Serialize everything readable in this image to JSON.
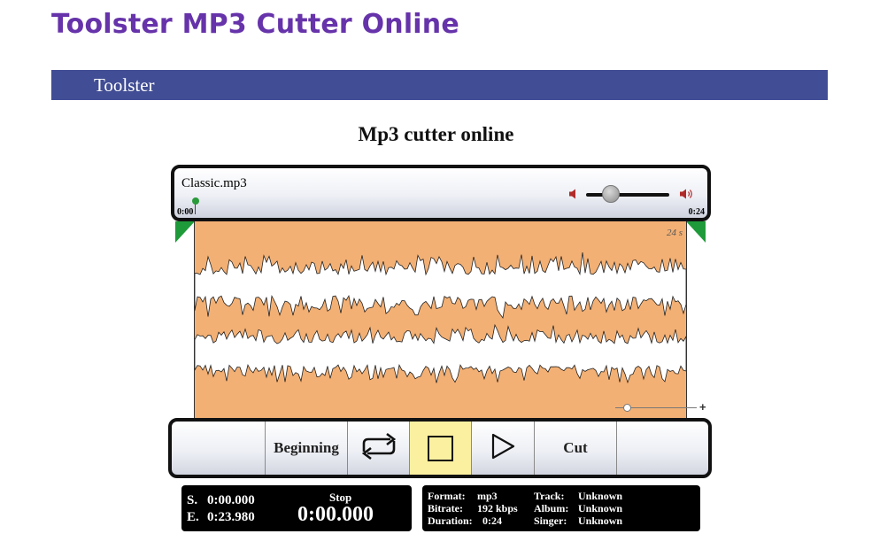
{
  "page": {
    "title": "Toolster MP3 Cutter Online"
  },
  "banner": {
    "brand": "Toolster"
  },
  "tool": {
    "title": "Mp3 cutter online"
  },
  "player": {
    "filename": "Classic.mp3",
    "time_start": "0:00",
    "time_end": "0:24",
    "volume_low_icon": "volume-low-icon",
    "volume_high_icon": "volume-high-icon",
    "volume_level": 0.25,
    "accent_color": "#2a9a3a"
  },
  "waveform": {
    "zoom_label": "24 s",
    "zoom_level": 0.1,
    "fill_color": "#f3b074",
    "handle_color": "#1f9a3a"
  },
  "controls": {
    "beginning_label": "Beginning",
    "loop_icon": "loop-icon",
    "stop_icon": "stop-icon",
    "play_icon": "play-icon",
    "cut_label": "Cut"
  },
  "selection": {
    "start_prefix": "S.",
    "start_value": "0:00.000",
    "end_prefix": "E.",
    "end_value": "0:23.980",
    "status": "Stop",
    "position": "0:00.000"
  },
  "file_info": {
    "format_label": "Format:",
    "format_value": "mp3",
    "bitrate_label": "Bitrate:",
    "bitrate_value": "192 kbps",
    "duration_label": "Duration:",
    "duration_value": "0:24",
    "track_label": "Track:",
    "track_value": "Unknown",
    "album_label": "Album:",
    "album_value": "Unknown",
    "singer_label": "Singer:",
    "singer_value": "Unknown"
  }
}
